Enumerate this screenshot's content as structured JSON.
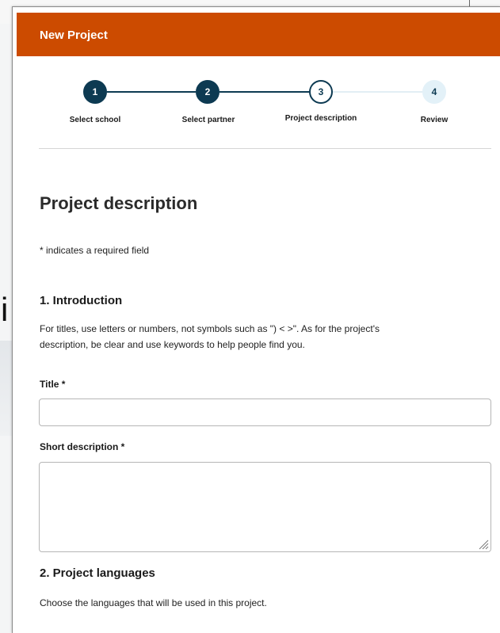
{
  "backdrop": {
    "glyph": "i"
  },
  "modal": {
    "title": "New Project"
  },
  "stepper": {
    "steps": [
      {
        "number": "1",
        "label": "Select school",
        "state": "done"
      },
      {
        "number": "2",
        "label": "Select partner",
        "state": "done"
      },
      {
        "number": "3",
        "label": "Project description",
        "state": "current"
      },
      {
        "number": "4",
        "label": "Review",
        "state": "todo"
      }
    ]
  },
  "page": {
    "heading": "Project description",
    "required_note": "* indicates a required field"
  },
  "introduction": {
    "heading": "1. Introduction",
    "help_line1": "For titles, use letters or numbers, not symbols such as \") < >\".   As for the project's",
    "help_line2": "description, be clear and use keywords to help people find you.",
    "title_label": "Title *",
    "title_value": "",
    "short_desc_label": "Short description *",
    "short_desc_value": ""
  },
  "languages": {
    "heading": "2. Project languages",
    "help": "Choose the languages that will be used in this project."
  },
  "colors": {
    "header_bg": "#cc4b00",
    "step_done": "#0d3a52",
    "step_todo": "#e3f1f8"
  }
}
